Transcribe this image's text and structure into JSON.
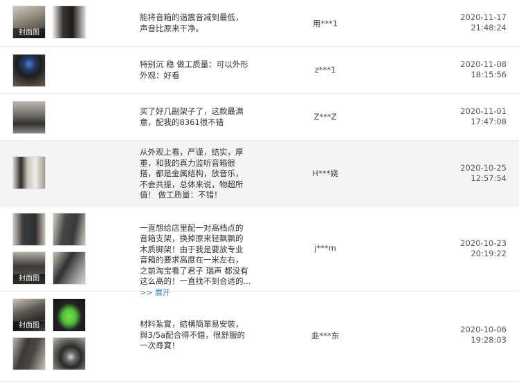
{
  "reviews": [
    {
      "text": "能将音箱的谐震音减到最低，\n声音比原来干净。",
      "user": "用***1",
      "date": "2020-11-17",
      "time": "21:48:24",
      "thumbs": [
        {
          "cover": "封面图"
        },
        {
          "cover": ""
        }
      ]
    },
    {
      "text": "特别沉 稳 做工质量：可以外形\n外观：好看",
      "user": "z***1",
      "date": "2020-11-08",
      "time": "18:15:56",
      "thumbs": [
        {
          "cover": ""
        }
      ]
    },
    {
      "text": "买了好几副架子了，这款最满\n意，配我的8361很不错",
      "user": "Z***Z",
      "date": "2020-11-01",
      "time": "17:47:08",
      "thumbs": [
        {
          "cover": ""
        }
      ]
    },
    {
      "text": "从外观上看，严谨，结实，厚\n重，和我的真力监听音箱很\n搭，都是金属结构，放音乐，\n不会共振，总体来说，物超所\n值！ 做工质量：不错！",
      "user": "H***娆",
      "date": "2020-10-25",
      "time": "12:57:54",
      "thumbs": [
        {
          "cover": ""
        }
      ]
    },
    {
      "text": "一直想给店里配一对高档点的\n音箱支架，换掉原来轻飘飘的\n木质脚架！由于我是要放专业\n音箱的要求高度在一米左右，\n之前淘宝看了君子 瑞声 都没有\n这么高的！一直找不到合适的...",
      "more": ">> 展开",
      "user": "j***m",
      "date": "2020-10-23",
      "time": "20:19:22",
      "thumbs": [
        {
          "cover": ""
        },
        {
          "cover": ""
        },
        {
          "cover": "封面图"
        },
        {
          "cover": ""
        }
      ]
    },
    {
      "text": "材料紮實，結構簡單易安裝，\n與3/5a配合得不錯，很舒服的\n一次尋寶！",
      "user": "韭***东",
      "date": "2020-10-06",
      "time": "19:28:03",
      "thumbs": [
        {
          "cover": "封面图"
        },
        {
          "cover": ""
        },
        {
          "cover": ""
        },
        {
          "cover": ""
        }
      ]
    }
  ]
}
